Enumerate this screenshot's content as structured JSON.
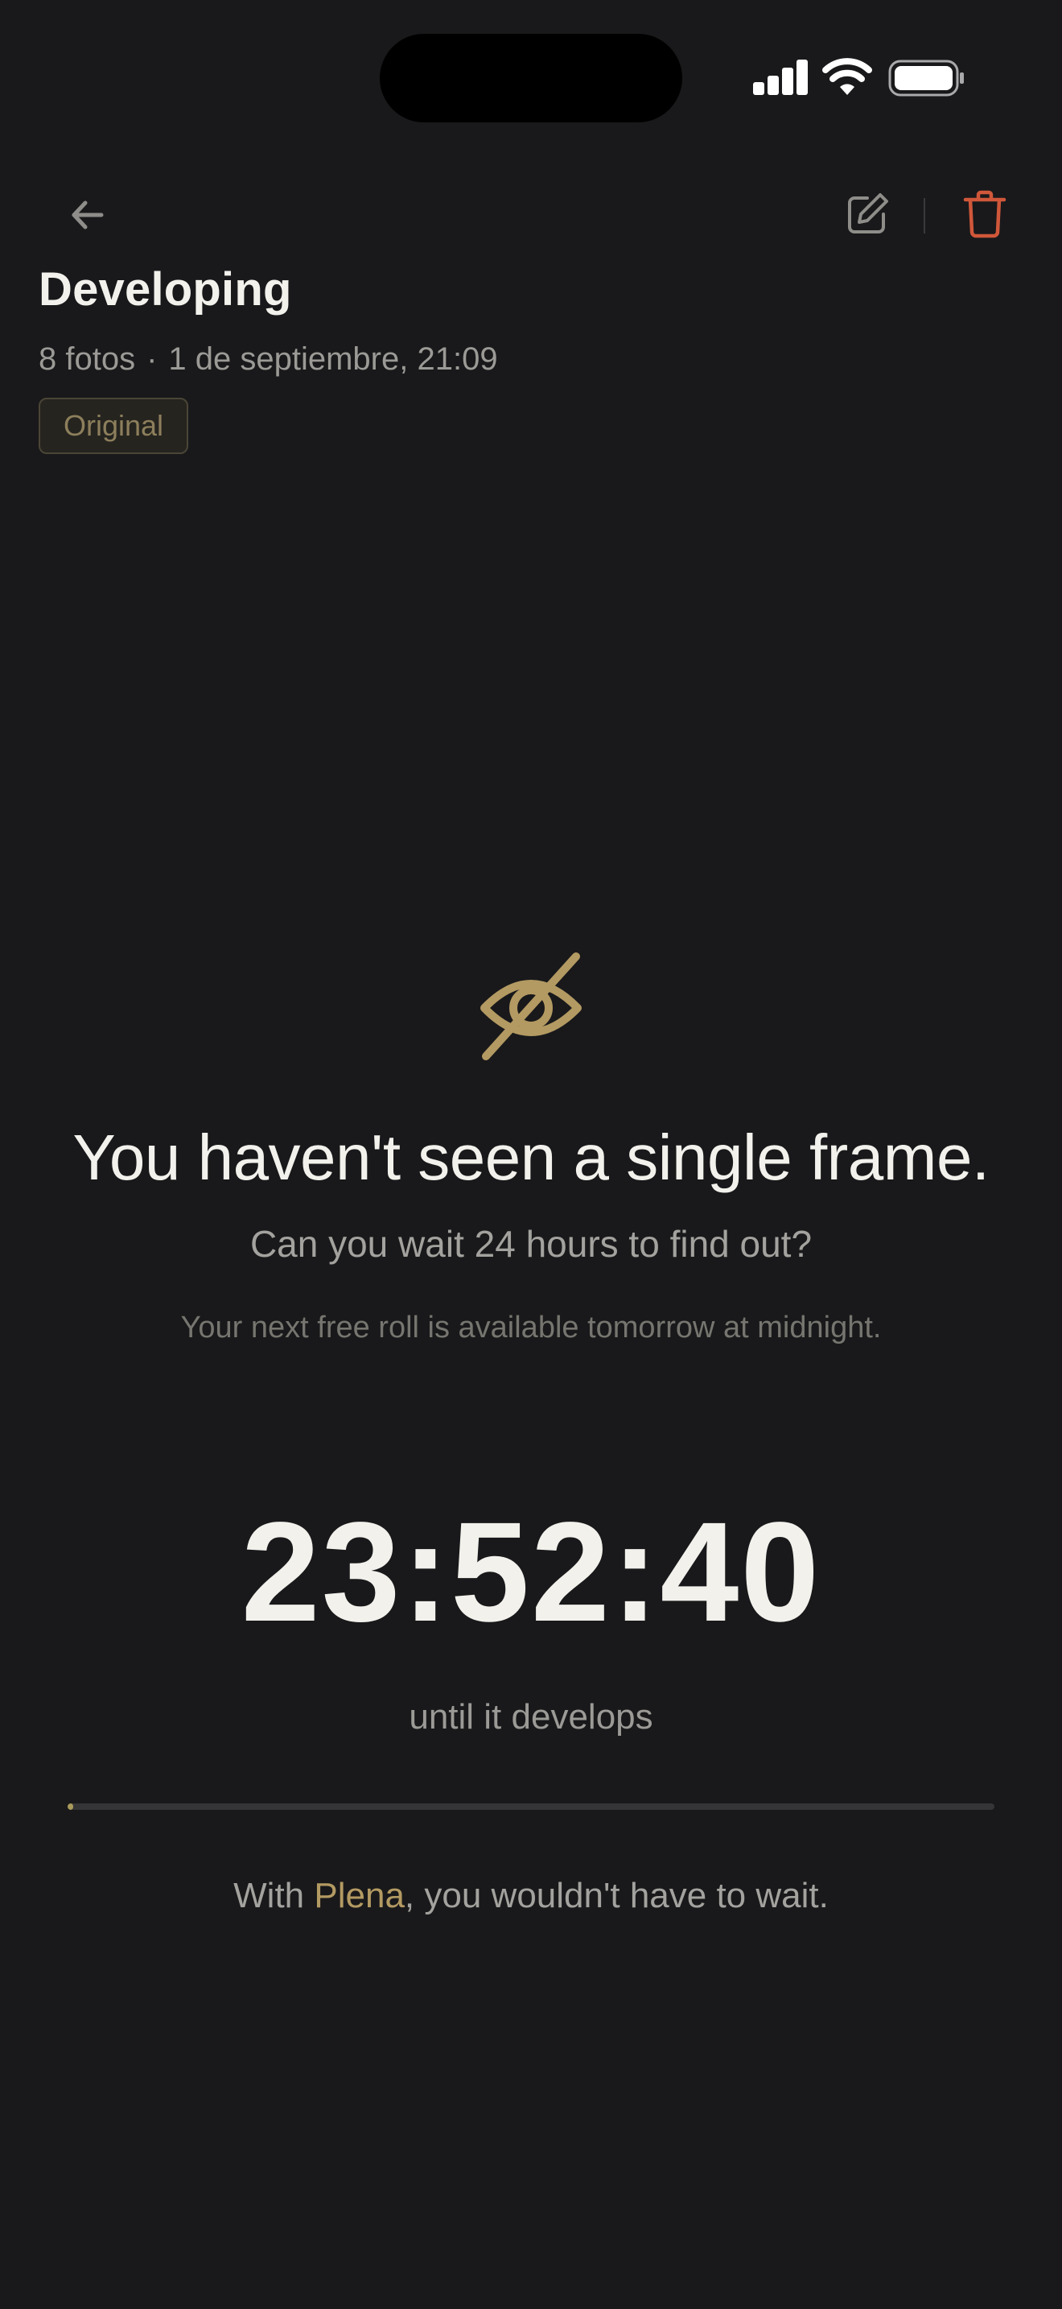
{
  "status_bar": {
    "icons": [
      "cellular-signal-icon",
      "wifi-icon",
      "battery-icon"
    ]
  },
  "nav": {
    "back_icon": "arrow-left-icon",
    "edit_icon": "pencil-square-icon",
    "delete_icon": "trash-icon",
    "delete_color": "#d0573a"
  },
  "header": {
    "title": "Developing",
    "photo_count": "8 fotos",
    "separator": "·",
    "date": "1 de septiembre, 21:09",
    "badge": "Original"
  },
  "main": {
    "icon": "eye-slash-icon",
    "accent_color": "#b39a62",
    "headline": "You haven't seen a single frame.",
    "subhead": "Can you wait 24 hours to find out?",
    "note": "Your next free roll is available tomorrow at midnight.",
    "countdown": "23:52:40",
    "countdown_label": "until it develops",
    "progress_fraction": 0.006,
    "upsell": {
      "prefix": "With ",
      "brand": "Plena",
      "suffix": ", you wouldn't have to wait."
    }
  }
}
